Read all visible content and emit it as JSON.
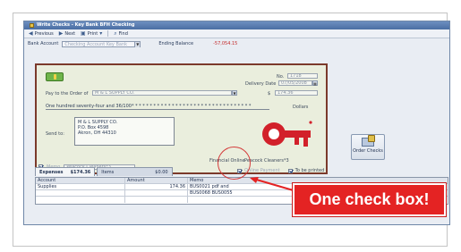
{
  "window": {
    "title": "Write Checks - Key Bank BFH Checking"
  },
  "toolbar": {
    "previous": "Previous",
    "next": "Next",
    "print": "Print",
    "find": "Find"
  },
  "account": {
    "label": "Bank Account",
    "value": "Checking Account Key Bank",
    "ending_balance_label": "Ending Balance",
    "ending_balance_value": "-57,054.15"
  },
  "check": {
    "no_label": "No.",
    "no_value": "1718",
    "delivery_label": "Delivery Date",
    "delivery_value": "07/05/2008",
    "payee_label": "Pay to the Order of",
    "payee_value": "M & L SUPPLY CO.",
    "dollar_sign": "$",
    "amount_value": "174.36",
    "amount_words": "One hundred seventy-four and 36/100* * * * * * * * * * * * * * * * * * * * * * * * * * * * * * * * *",
    "dollars_label": "Dollars",
    "send_to_label": "Send to:",
    "address_lines": [
      "M & L SUPPLY CO.",
      "P.O. Box 4598",
      "Akron, OH 44310"
    ],
    "memo_label": "Memo",
    "memo_value": "Peacock Cleaners*3",
    "online_label": "Financial Online",
    "online_value": "Peacock Cleaners*3"
  },
  "order_checks": {
    "label": "Order Checks"
  },
  "tabs": [
    {
      "label": "Expenses",
      "amount": "$174.36"
    },
    {
      "label": "Items",
      "amount": "$0.00"
    }
  ],
  "options": {
    "online_payment": "Online Payment",
    "to_be_printed": "To be printed"
  },
  "grid": {
    "headers": [
      "Account",
      "Amount",
      "Memo"
    ],
    "rows": [
      {
        "account": "Supplies",
        "amount": "174.36",
        "memo": "BUS0021 pdf and"
      },
      {
        "account": "",
        "amount": "",
        "memo": "BUS0068 BUS0055"
      }
    ]
  },
  "callout": {
    "text": "One check box!"
  },
  "colors": {
    "check_border": "#7b3a2b",
    "callout": "#e42323",
    "key_logo": "#d2202a"
  }
}
